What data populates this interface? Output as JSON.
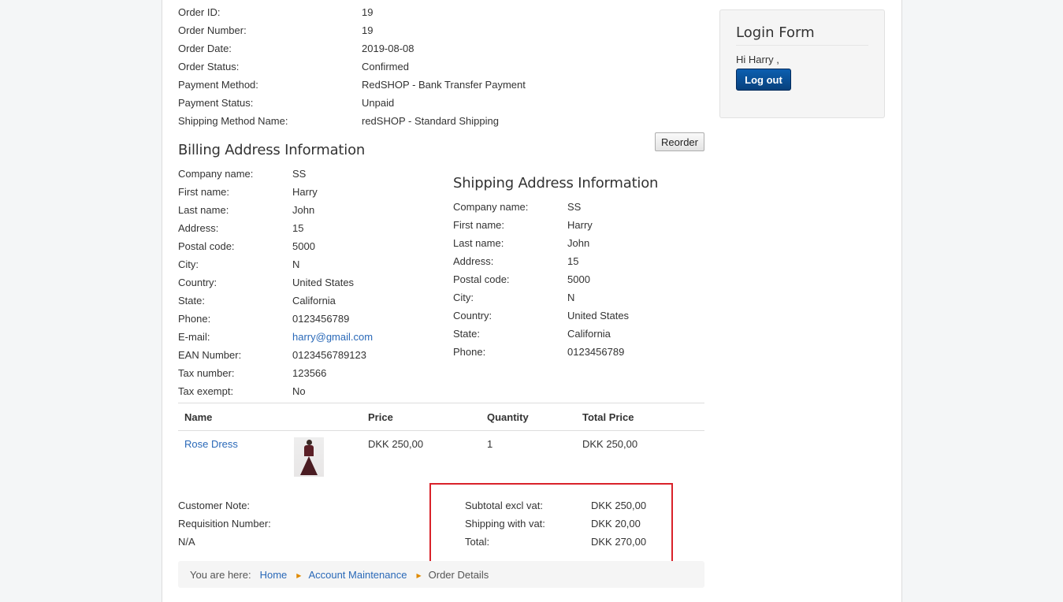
{
  "order_info": [
    {
      "label": "Order ID:",
      "value": "19"
    },
    {
      "label": "Order Number:",
      "value": "19"
    },
    {
      "label": "Order Date:",
      "value": "2019-08-08"
    },
    {
      "label": "Order Status:",
      "value": "Confirmed"
    },
    {
      "label": "Payment Method:",
      "value": "RedSHOP - Bank Transfer Payment"
    },
    {
      "label": "Payment Status:",
      "value": "Unpaid"
    },
    {
      "label": "Shipping Method Name:",
      "value": "redSHOP - Standard Shipping"
    }
  ],
  "reorder_label": "Reorder",
  "billing": {
    "title": "Billing Address Information",
    "fields": [
      {
        "label": "Company name:",
        "value": "SS"
      },
      {
        "label": "First name:",
        "value": "Harry"
      },
      {
        "label": "Last name:",
        "value": "John"
      },
      {
        "label": "Address:",
        "value": "15"
      },
      {
        "label": "Postal code:",
        "value": "5000"
      },
      {
        "label": "City:",
        "value": "N"
      },
      {
        "label": "Country:",
        "value": "United States"
      },
      {
        "label": "State:",
        "value": "California"
      },
      {
        "label": "Phone:",
        "value": "0123456789"
      },
      {
        "label": "E-mail:",
        "value": "harry@gmail.com"
      },
      {
        "label": "EAN Number:",
        "value": "0123456789123"
      },
      {
        "label": "Tax number:",
        "value": "123566"
      },
      {
        "label": "Tax exempt:",
        "value": "No"
      }
    ]
  },
  "shipping": {
    "title": "Shipping Address Information",
    "fields": [
      {
        "label": "Company name:",
        "value": "SS"
      },
      {
        "label": "First name:",
        "value": "Harry"
      },
      {
        "label": "Last name:",
        "value": "John"
      },
      {
        "label": "Address:",
        "value": "15"
      },
      {
        "label": "Postal code:",
        "value": "5000"
      },
      {
        "label": "City:",
        "value": "N"
      },
      {
        "label": "Country:",
        "value": "United States"
      },
      {
        "label": "State:",
        "value": "California"
      },
      {
        "label": "Phone:",
        "value": "0123456789"
      }
    ]
  },
  "items": {
    "headers": {
      "name": "Name",
      "price": "Price",
      "quantity": "Quantity",
      "total": "Total Price"
    },
    "rows": [
      {
        "name": "Rose Dress",
        "image": "dress-thumbnail",
        "price": "DKK 250,00",
        "quantity": "1",
        "total": "DKK 250,00"
      }
    ]
  },
  "notes": {
    "customer_note_label": "Customer Note:",
    "requisition_label": "Requisition Number:",
    "requisition_value": "N/A"
  },
  "totals": [
    {
      "label": "Subtotal excl vat:",
      "value": "DKK 250,00"
    },
    {
      "label": "Shipping with vat:",
      "value": "DKK 20,00"
    },
    {
      "label": "Total:",
      "value": "DKK 270,00"
    }
  ],
  "breadcrumb": {
    "prefix": "You are here:",
    "items": [
      "Home",
      "Account Maintenance",
      "Order Details"
    ]
  },
  "login": {
    "title": "Login Form",
    "greeting": "Hi Harry ,",
    "logout_label": "Log out"
  },
  "colors": {
    "link": "#2a69b8",
    "highlight": "#d9222a",
    "button": "#08417d"
  }
}
